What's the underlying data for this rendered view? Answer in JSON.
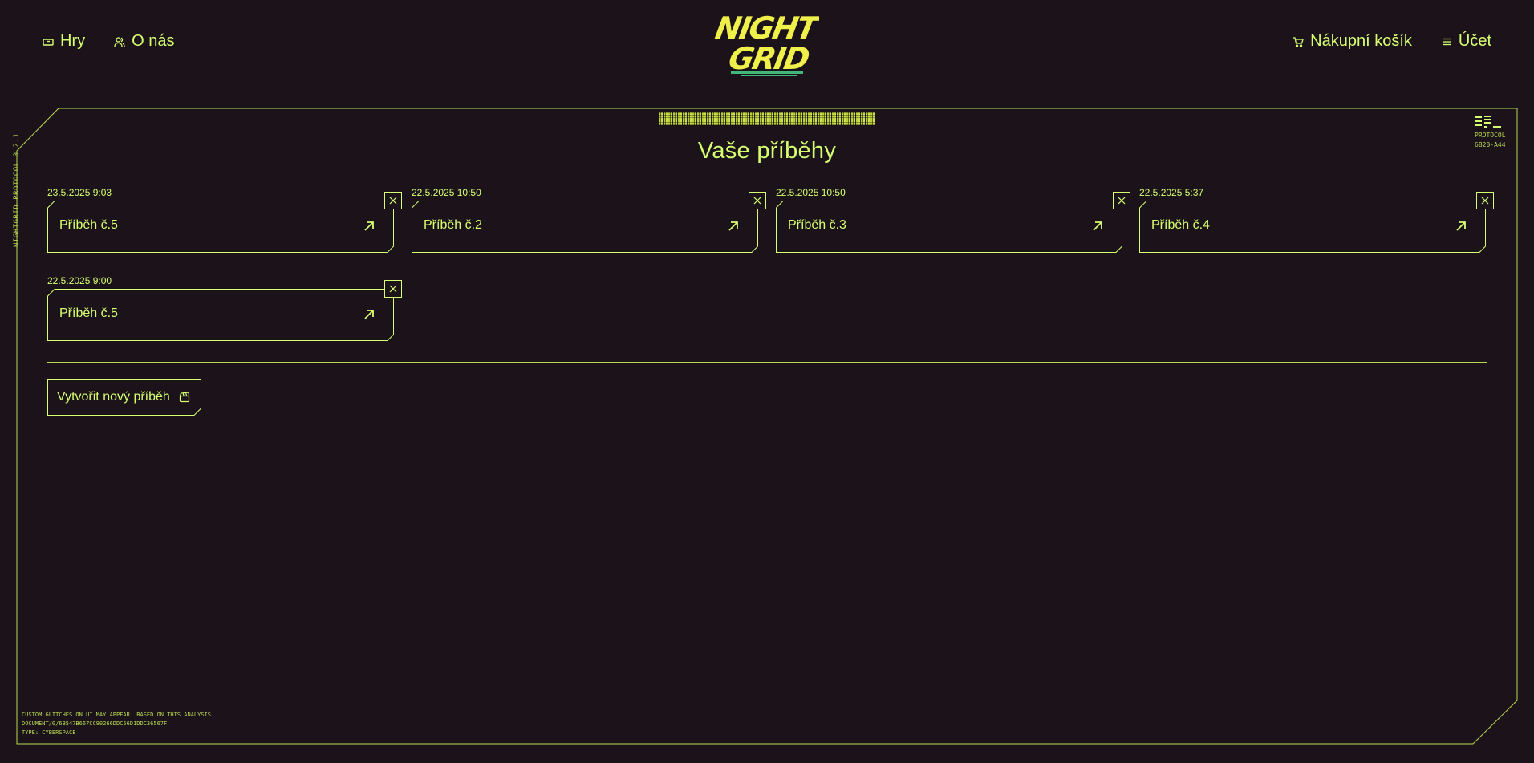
{
  "header": {
    "nav_left": [
      {
        "label": "Hry",
        "icon": "ticket-icon"
      },
      {
        "label": "O nás",
        "icon": "users-icon"
      }
    ],
    "nav_right": [
      {
        "label": "Nákupní košík",
        "icon": "cart-icon"
      },
      {
        "label": "Účet",
        "icon": "menu-icon"
      }
    ],
    "logo": {
      "line1": "NIGHT",
      "line2": "GRID"
    }
  },
  "frame": {
    "side_text": "NIGHTGRID PROTOCOL 0.2.1",
    "protocol_label": "PROTOCOL",
    "protocol_code": "6820-A44",
    "footer_lines": [
      "CUSTOM GLITCHES ON UI MAY APPEAR. BASED ON THIS ANALYSIS.",
      "DOCUMENT/0/6b547b667cc90266ddc56d1ddc36567f",
      "TYPE: CYBERSPACE"
    ]
  },
  "main": {
    "title": "Vaše příběhy",
    "stories": [
      {
        "date": "23.5.2025 9:03",
        "title": "Příběh č.5"
      },
      {
        "date": "22.5.2025 10:50",
        "title": "Příběh č.2"
      },
      {
        "date": "22.5.2025 10:50",
        "title": "Příběh č.3"
      },
      {
        "date": "22.5.2025 5:37",
        "title": "Příběh č.4"
      },
      {
        "date": "22.5.2025 9:00",
        "title": "Příběh č.5"
      }
    ],
    "create_button": "Vytvořit nový příběh"
  },
  "colors": {
    "background": "#1c131a",
    "accent": "#d6ff6f",
    "logo_yellow": "#f0f04a",
    "logo_green": "#3fb87a"
  }
}
